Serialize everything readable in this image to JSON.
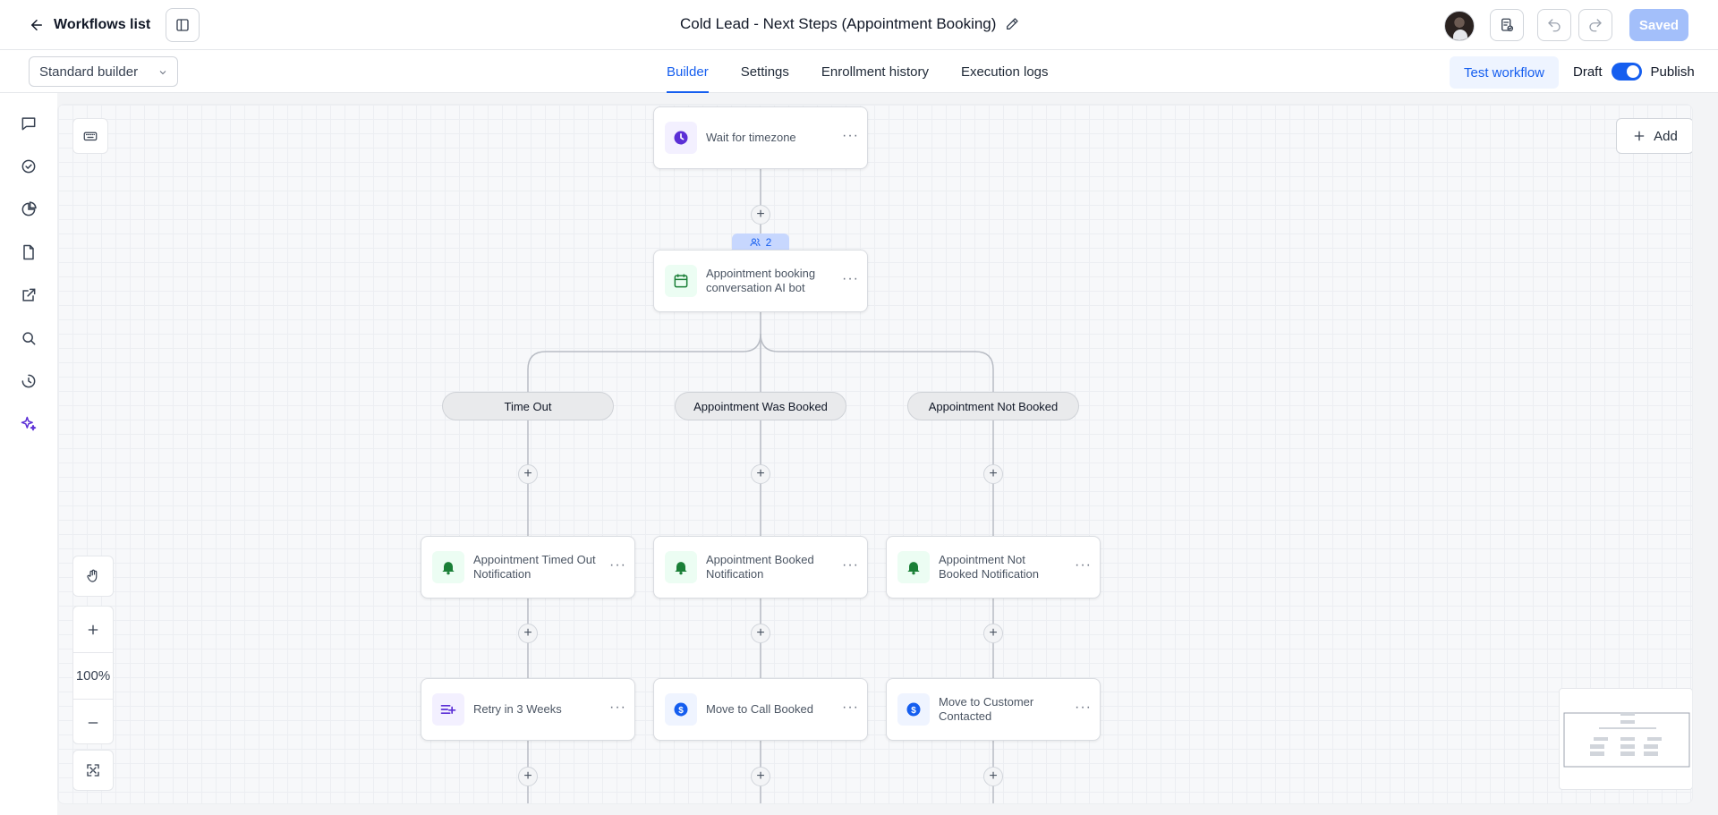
{
  "header": {
    "back_label": "Workflows list",
    "workflow_title": "Cold Lead - Next Steps (Appointment Booking)",
    "saved_label": "Saved"
  },
  "subbar": {
    "builder_mode": "Standard builder",
    "tabs": [
      {
        "label": "Builder",
        "active": true
      },
      {
        "label": "Settings",
        "active": false
      },
      {
        "label": "Enrollment history",
        "active": false
      },
      {
        "label": "Execution logs",
        "active": false
      }
    ],
    "test_label": "Test workflow",
    "draft_label": "Draft",
    "publish_label": "Publish",
    "published": true
  },
  "rail_icons": [
    "chat-icon",
    "check-circle-icon",
    "pie-chart-icon",
    "document-icon",
    "external-link-icon",
    "search-icon",
    "history-icon",
    "sparkle-icon"
  ],
  "canvas": {
    "add_label": "Add",
    "zoom_level": "100%",
    "flow": {
      "wait_node": {
        "label": "Wait for timezone",
        "icon": "clock-icon"
      },
      "contacts_count": "2",
      "ai_node": {
        "label": "Appointment booking conversation AI bot",
        "icon": "calendar-icon"
      },
      "branches": [
        "Time Out",
        "Appointment Was Booked",
        "Appointment Not Booked"
      ],
      "notification_nodes": [
        {
          "label": "Appointment Timed Out Notification",
          "icon": "bell-icon"
        },
        {
          "label": "Appointment Booked Notification",
          "icon": "bell-icon"
        },
        {
          "label": "Appointment Not Booked Notification",
          "icon": "bell-icon"
        }
      ],
      "action_nodes": [
        {
          "label": "Retry in 3 Weeks",
          "icon": "list-add-icon"
        },
        {
          "label": "Move to Call Booked",
          "icon": "dollar-icon"
        },
        {
          "label": "Move to Customer Contacted",
          "icon": "dollar-icon"
        }
      ]
    }
  },
  "colors": {
    "accent": "#155eef",
    "purple": "#5b2fd6",
    "green": "#1a7f37"
  }
}
